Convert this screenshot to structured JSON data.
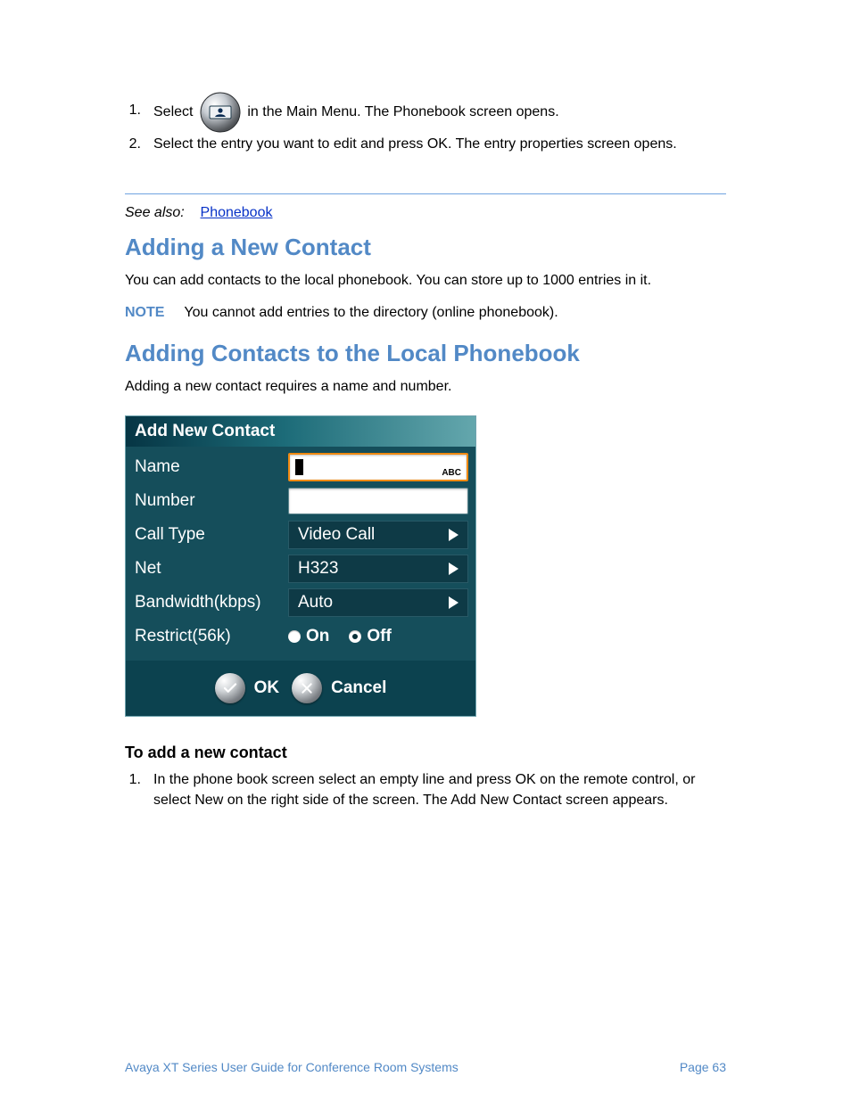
{
  "steps": {
    "s1_num": "1.",
    "s1_text_a": "Select ",
    "s1_text_b": " in the Main Menu. The Phonebook screen opens.",
    "s2_num": "2.",
    "s2_text": "Select the entry you want to edit and press OK. The entry properties screen opens."
  },
  "see_also": {
    "label": "See also:",
    "link": "Phonebook"
  },
  "section": {
    "title": "Adding a New Contact",
    "p1": "You can add contacts to the local phonebook. You can store up to 1000 entries in it.",
    "note_label": "NOTE",
    "note_text": "You cannot add entries to the directory (online phonebook).",
    "proc_title": "Adding Contacts to the Local Phonebook",
    "p2": "Adding a new contact requires a name and number."
  },
  "dialog": {
    "title": "Add New Contact",
    "name_label": "Name",
    "name_value": "",
    "name_mode": "ABC",
    "number_label": "Number",
    "number_value": "",
    "calltype_label": "Call Type",
    "calltype_value": "Video Call",
    "net_label": "Net",
    "net_value": "H323",
    "bandwidth_label": "Bandwidth(kbps)",
    "bandwidth_value": "Auto",
    "restrict_label": "Restrict(56k)",
    "restrict_on": "On",
    "restrict_off": "Off",
    "restrict_selected": "Off",
    "ok": "OK",
    "cancel": "Cancel"
  },
  "post": {
    "sub": "To add a new contact",
    "s1_num": "1.",
    "s1_text": "In the phone book screen select an empty line and press OK on the remote control, or select New on the right side of the screen. The Add New Contact screen appears."
  },
  "footer": {
    "doc": "Avaya XT Series User Guide for Conference Room Systems",
    "page": "Page 63"
  }
}
